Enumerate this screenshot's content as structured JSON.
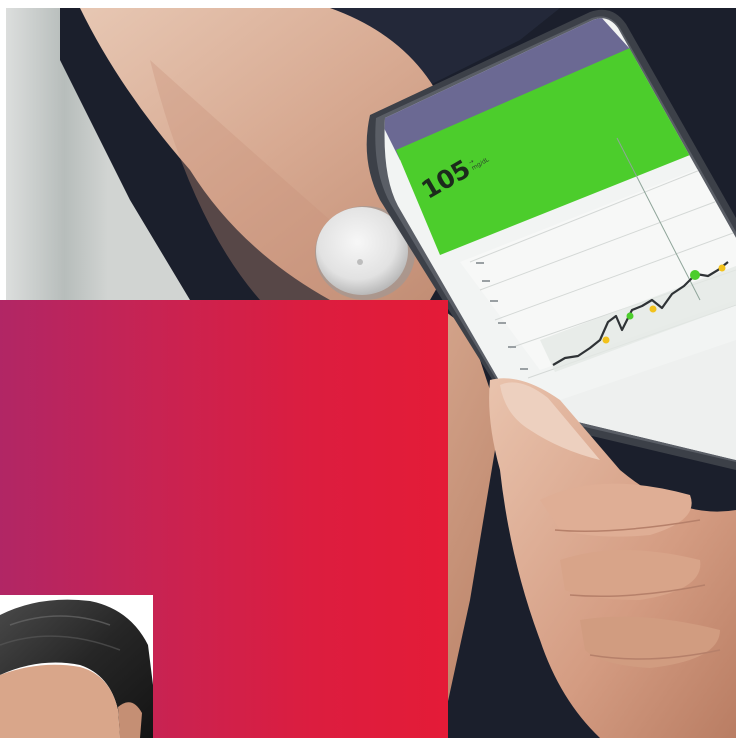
{
  "phone": {
    "glucose_value": "105",
    "glucose_unit_top": "→",
    "glucose_unit_bottom": "mg/dL"
  },
  "colors": {
    "gradient_start": "#b12665",
    "gradient_end": "#e41b37",
    "app_header_green": "#4ccd2c",
    "sensor_white": "#e9e9e9"
  },
  "icons": {
    "sensor": "glucose-sensor-icon",
    "trend": "trend-arrow-icon"
  }
}
